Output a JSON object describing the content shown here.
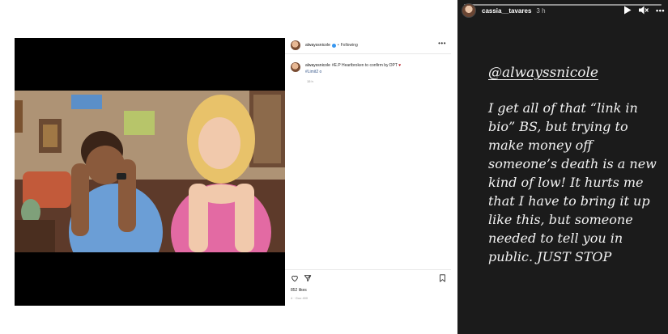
{
  "post": {
    "username": "alwayssnicole",
    "follow_status": "Following",
    "separator": "•",
    "more": "•••",
    "caption_user": "alwayssnicole",
    "caption_text": "#E.P Heartbroken to confirm by DPT",
    "caption_hashtag": "#Limit2 o",
    "caption_time": "15 h",
    "likes": "852 likes",
    "date": "4 · Goo 400"
  },
  "story": {
    "username": "cassia__tavares",
    "time": "3 h",
    "more": "•••",
    "mention": "@alwayssnicole",
    "text": "I get all of that “link in bio” BS, but trying to make money off someone’s death is a new kind of low! It hurts me that I have to bring it up like this, but someone needed to tell you in public. JUST STOP"
  },
  "colors": {
    "story_bg": "#1b1b1b",
    "verified_blue": "#3897f0",
    "post_bg": "#ffffff"
  },
  "icons": [
    "heart-icon",
    "share-icon",
    "bookmark-icon",
    "play-icon",
    "mute-icon",
    "more-icon",
    "verified-icon"
  ]
}
